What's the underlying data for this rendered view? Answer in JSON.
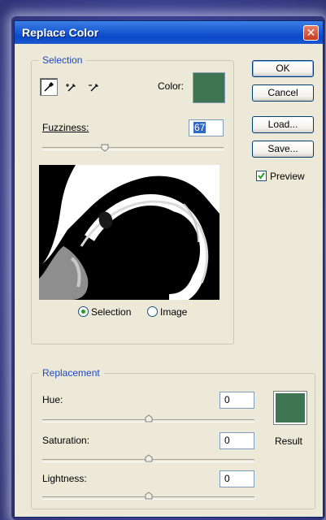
{
  "window": {
    "title": "Replace Color",
    "close_glyph": "✕"
  },
  "selection": {
    "legend": "Selection",
    "color_label": "Color:",
    "fuzziness_label": "Fuzziness:",
    "fuzziness_value": "67",
    "fuzziness_level_percent": 33,
    "swatch_color": "#407553",
    "radio_selection": "Selection",
    "radio_image": "Image",
    "selected_radio": "Selection"
  },
  "buttons": {
    "ok": "OK",
    "cancel": "Cancel",
    "load": "Load...",
    "save": "Save..."
  },
  "preview": {
    "label": "Preview",
    "checked": true
  },
  "replacement": {
    "legend": "Replacement",
    "hue_label": "Hue:",
    "hue_value": "0",
    "saturation_label": "Saturation:",
    "saturation_value": "0",
    "lightness_label": "Lightness:",
    "lightness_value": "0",
    "result_label": "Result",
    "result_color": "#407553"
  },
  "icons": [
    "eyedropper-icon",
    "eyedropper-plus-icon",
    "eyedropper-minus-icon",
    "close-icon",
    "check-icon"
  ]
}
